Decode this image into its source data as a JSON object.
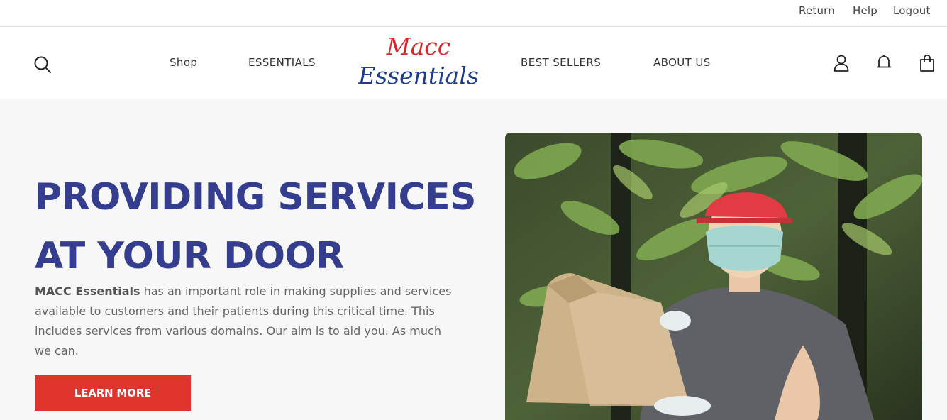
{
  "topbar": {
    "return_label": "Return",
    "help_label": "Help",
    "logout_label": "Logout"
  },
  "header": {
    "nav": {
      "shop": "Shop",
      "essentials": "ESSENTIALS",
      "best_sellers": "BEST SELLERS",
      "about_us": "ABOUT US"
    },
    "logo": {
      "line1": "Macc",
      "line2": "Essentials"
    },
    "icons": [
      "search-icon",
      "user-icon",
      "bell-icon",
      "shopping-bag-icon"
    ]
  },
  "hero": {
    "title_line1": "PROVIDING SERVICES",
    "title_line2": "AT YOUR DOOR",
    "body_brand": "MACC Essentials",
    "body_text": " has an important role in making supplies and services available to customers and their patients during this critical time. This includes services from various domains. Our aim is to aid you. As much we can.",
    "cta_label": "LEARN MORE"
  },
  "colors": {
    "title_blue": "#353e8e",
    "cta_red": "#e0342d",
    "logo_red": "#d6262b",
    "logo_blue": "#1e3d8f",
    "hero_bg": "#f7f7f7"
  }
}
